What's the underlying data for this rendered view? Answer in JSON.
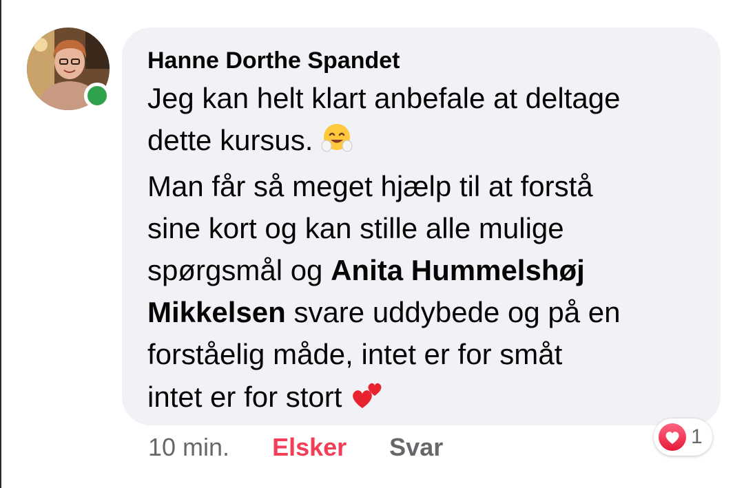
{
  "comment": {
    "author": "Hanne Dorthe Spandet",
    "lines": {
      "l1": "Jeg kan helt klart anbefale at deltage",
      "l2": "dette kursus.",
      "l3": " Man får så meget hjælp til at forstå",
      "l4": "sine kort og kan stille alle mulige",
      "l5_pre": "spørgsmål og ",
      "l5_mention": "Anita Hummelshøj",
      "l6_mention": "Mikkelsen",
      "l6_post": " svare uddybede og på en",
      "l7": "forståelig måde, intet er for småt",
      "l8": "intet er for stort"
    },
    "emojis": [
      "hugging-face",
      "two-hearts"
    ],
    "online": true
  },
  "actions": {
    "time": "10 min.",
    "love": "Elsker",
    "reply": "Svar"
  },
  "reactions": {
    "type": "love",
    "count": "1"
  },
  "colors": {
    "bubble": "#f0f2f5",
    "online": "#31a24c",
    "love": "#f33e58",
    "muted": "#65676b"
  }
}
